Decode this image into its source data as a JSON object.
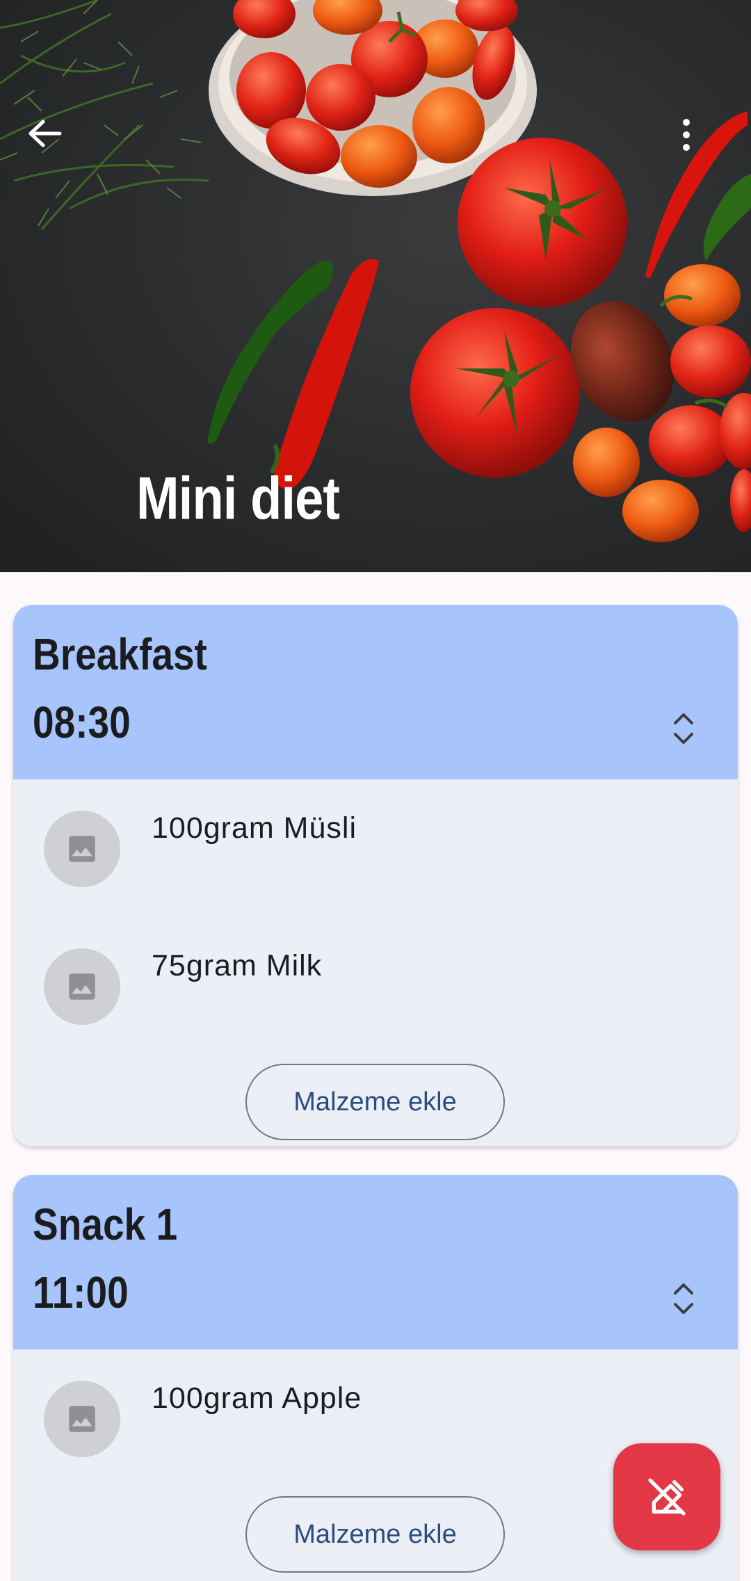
{
  "diet": {
    "title": "Mini diet"
  },
  "meals": [
    {
      "name": "Breakfast",
      "time": "08:30",
      "ingredients": [
        "100gram Müsli",
        "75gram Milk"
      ],
      "add_label": "Malzeme ekle"
    },
    {
      "name": "Snack 1",
      "time": "11:00",
      "ingredients": [
        "100gram Apple"
      ],
      "add_label": "Malzeme ekle"
    }
  ],
  "icons": {
    "back": "arrow-back-icon",
    "more": "more-vert-icon",
    "expand": "unfold-icon",
    "ingredient_placeholder": "image-icon",
    "fab": "edit-off-icon"
  },
  "colors": {
    "card_header": "#a7c5fb",
    "card_body": "#eceff6",
    "fab": "#e33746",
    "button_text": "#2b4c7e"
  }
}
